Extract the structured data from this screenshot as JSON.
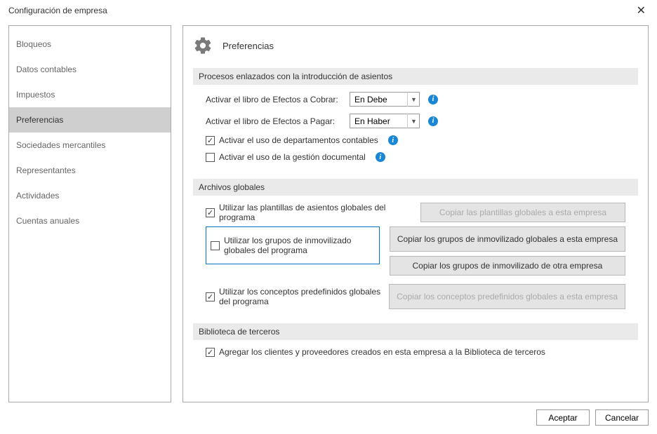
{
  "window": {
    "title": "Configuración de empresa"
  },
  "sidebar": {
    "items": [
      {
        "label": "Bloqueos"
      },
      {
        "label": "Datos contables"
      },
      {
        "label": "Impuestos"
      },
      {
        "label": "Preferencias"
      },
      {
        "label": "Sociedades mercantiles"
      },
      {
        "label": "Representantes"
      },
      {
        "label": "Actividades"
      },
      {
        "label": "Cuentas anuales"
      }
    ]
  },
  "main": {
    "title": "Preferencias",
    "section1": {
      "header": "Procesos enlazados con la introducción de asientos",
      "row1_label": "Activar el libro de Efectos a Cobrar:",
      "row1_value": "En Debe",
      "row2_label": "Activar el libro de Efectos a Pagar:",
      "row2_value": "En Haber",
      "check1": "Activar el uso de departamentos contables",
      "check2": "Activar el uso de la gestión documental"
    },
    "section2": {
      "header": "Archivos globales",
      "check1": "Utilizar las plantillas de asientos globales del programa",
      "btn1": "Copiar las plantillas globales a esta empresa",
      "check2": "Utilizar los grupos de inmovilizado globales del programa",
      "btn2a": "Copiar los grupos de inmovilizado globales a esta empresa",
      "btn2b": "Copiar los grupos de inmovilizado de otra empresa",
      "check3": "Utilizar los conceptos predefinidos globales del programa",
      "btn3": "Copiar los conceptos predefinidos globales a esta empresa"
    },
    "section3": {
      "header": "Biblioteca de terceros",
      "check1": "Agregar los clientes y proveedores creados en esta empresa a la Biblioteca de terceros"
    }
  },
  "footer": {
    "accept": "Aceptar",
    "cancel": "Cancelar"
  }
}
